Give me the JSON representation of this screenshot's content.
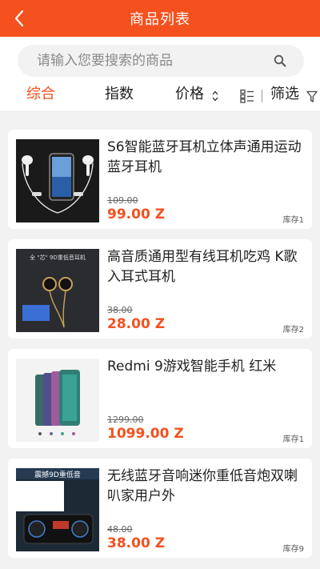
{
  "header": {
    "title": "商品列表",
    "back_icon": "chevron-left-icon"
  },
  "search": {
    "placeholder": "请输入您要搜索的商品",
    "icon": "search-icon"
  },
  "filters": {
    "tabs": [
      {
        "label": "综合",
        "active": true
      },
      {
        "label": "指数",
        "active": false
      },
      {
        "label": "价格",
        "active": false
      }
    ],
    "filter_label": "筛选"
  },
  "colors": {
    "accent": "#f4511e",
    "background": "#f2f2f2"
  },
  "products": [
    {
      "name": "S6智能蓝牙耳机立体声通用运动蓝牙耳机",
      "old_price": "109.00",
      "price": "99.00 Z",
      "stock": "库存1"
    },
    {
      "name": "高音质通用型有线耳机吃鸡 K歌入耳式耳机",
      "old_price": "38.00",
      "price": "28.00 Z",
      "stock": "库存2",
      "image_text": "全 \"芯\" 9D重低音耳机"
    },
    {
      "name": "Redmi 9游戏智能手机 红米",
      "old_price": "1299.00",
      "price": "1099.00 Z",
      "stock": "库存1"
    },
    {
      "name": "无线蓝牙音响迷你重低音炮双喇叭家用户外",
      "old_price": "48.00",
      "price": "38.00 Z",
      "stock": "库存9",
      "image_text": "震撼9D重低音"
    }
  ]
}
